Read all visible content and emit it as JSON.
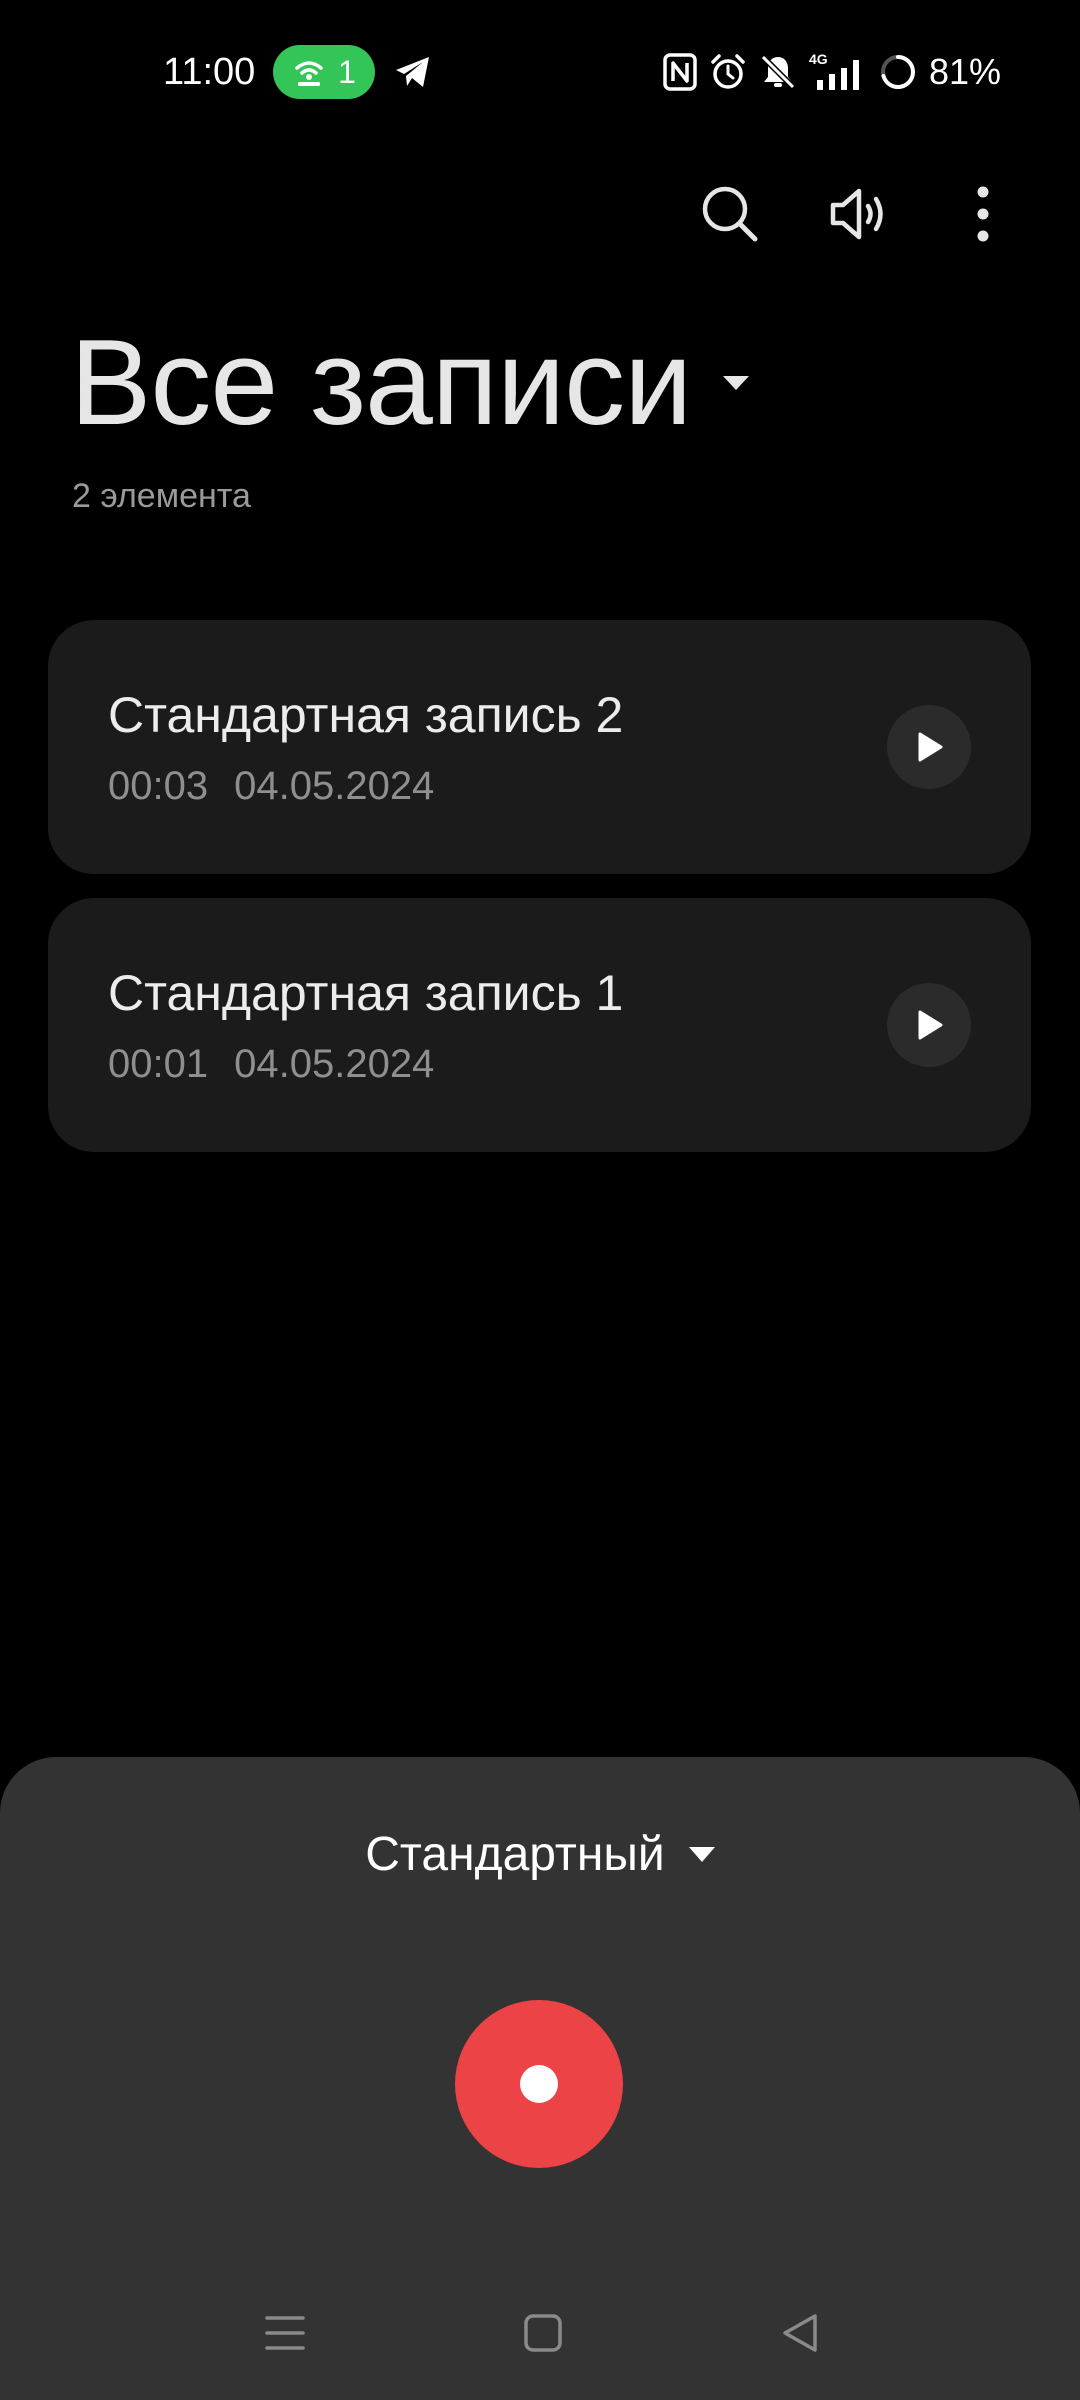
{
  "status_bar": {
    "time": "11:00",
    "hotspot_count": "1",
    "hotspot_color": "#34c559",
    "network_type": "4G",
    "battery": "81%",
    "icons": [
      "hotspot-icon",
      "telegram-icon",
      "nfc-icon",
      "alarm-icon",
      "bell-off-icon",
      "signal-icon",
      "battery-icon"
    ]
  },
  "toolbar": {
    "icons": [
      "search-icon",
      "speaker-icon",
      "more-vertical-icon"
    ]
  },
  "header": {
    "title": "Все записи",
    "count": "2 элемента"
  },
  "recordings": [
    {
      "name": "Стандартная запись 2",
      "duration": "00:03",
      "date": "04.05.2024"
    },
    {
      "name": "Стандартная запись 1",
      "duration": "00:01",
      "date": "04.05.2024"
    }
  ],
  "recorder": {
    "mode": "Стандартный",
    "record_button_color": "#ec4446"
  },
  "nav_bar": {
    "icons": [
      "menu-icon",
      "home-icon",
      "back-icon"
    ]
  }
}
